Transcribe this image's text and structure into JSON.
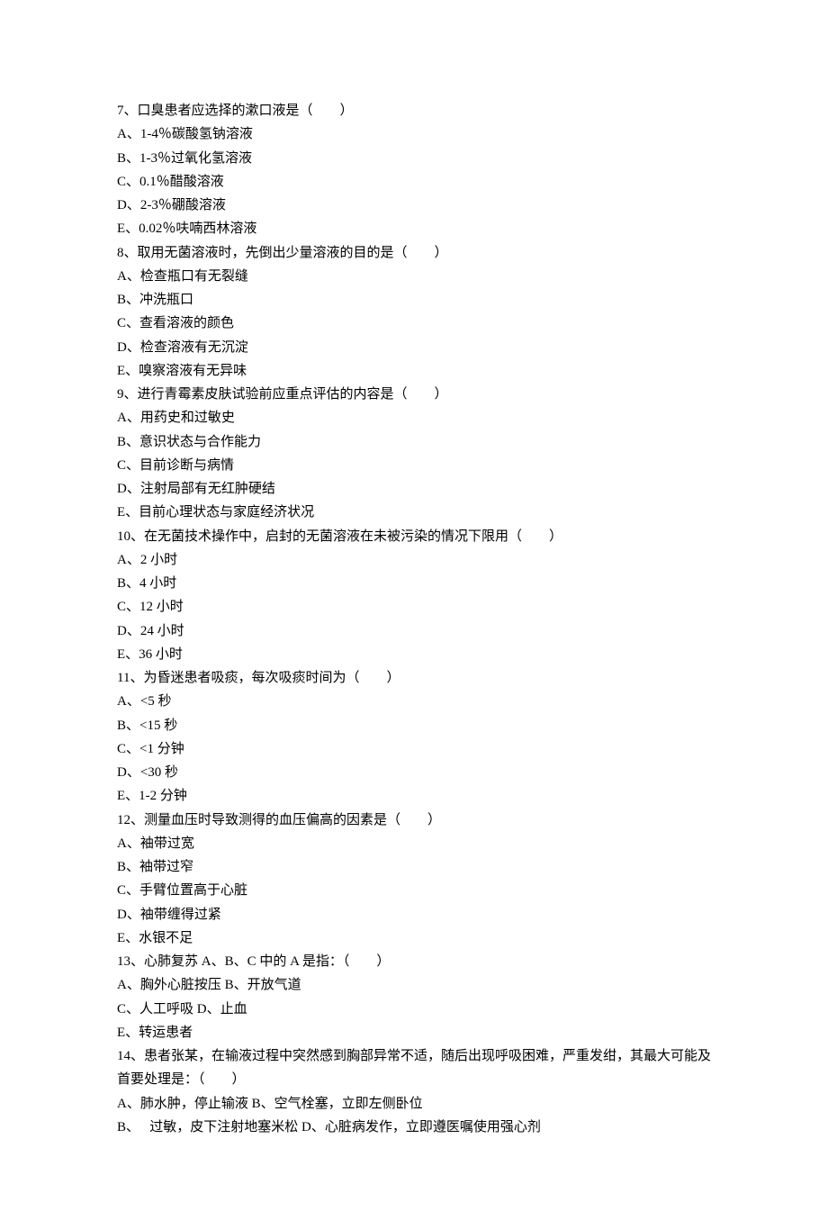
{
  "questions": [
    {
      "stem": "7、口臭患者应选择的漱口液是（　　）",
      "options": [
        "A、1-4％碳酸氢钠溶液",
        "B、1-3％过氧化氢溶液",
        "C、0.1％醋酸溶液",
        "D、2-3％硼酸溶液",
        "E、0.02％呋喃西林溶液"
      ]
    },
    {
      "stem": "8、取用无菌溶液时，先倒出少量溶液的目的是（　　）",
      "options": [
        "A、检查瓶口有无裂缝",
        "B、冲洗瓶口",
        "C、查看溶液的颜色",
        "D、检查溶液有无沉淀",
        "E、嗅察溶液有无异味"
      ]
    },
    {
      "stem": "9、进行青霉素皮肤试验前应重点评估的内容是（　　）",
      "options": [
        "A、用药史和过敏史",
        "B、意识状态与合作能力",
        "C、目前诊断与病情",
        "D、注射局部有无红肿硬结",
        "E、目前心理状态与家庭经济状况"
      ]
    },
    {
      "stem": "10、在无菌技术操作中，启封的无菌溶液在未被污染的情况下限用（　　）",
      "options": [
        "A、2 小时",
        "B、4 小时",
        "C、12 小时",
        "D、24 小时",
        "E、36 小时"
      ]
    },
    {
      "stem": "11、为昏迷患者吸痰，每次吸痰时间为（　　）",
      "options": [
        "A、<5 秒",
        "B、<15 秒",
        "C、<1 分钟",
        "D、<30 秒",
        "E、1-2 分钟"
      ]
    },
    {
      "stem": "12、测量血压时导致测得的血压偏高的因素是（　　）",
      "options": [
        "A、袖带过宽",
        "B、袖带过窄",
        "C、手臂位置高于心脏",
        "D、袖带缠得过紧",
        "E、水银不足"
      ]
    },
    {
      "stem": "13、心肺复苏 A、B、C 中的 A 是指：（　　）",
      "options": [
        "A、胸外心脏按压 B、开放气道",
        "C、人工呼吸 D、止血",
        "E、转运患者"
      ]
    },
    {
      "stem": "14、患者张某，在输液过程中突然感到胸部异常不适，随后出现呼吸困难，严重发绀，其最大可能及首要处理是：（　　）",
      "options": [
        "A、肺水肿，停止输液 B、空气栓塞，立即左侧卧位",
        "B、　 过敏，皮下注射地塞米松 D、心脏病发作，立即遵医嘱使用强心剂"
      ]
    }
  ]
}
